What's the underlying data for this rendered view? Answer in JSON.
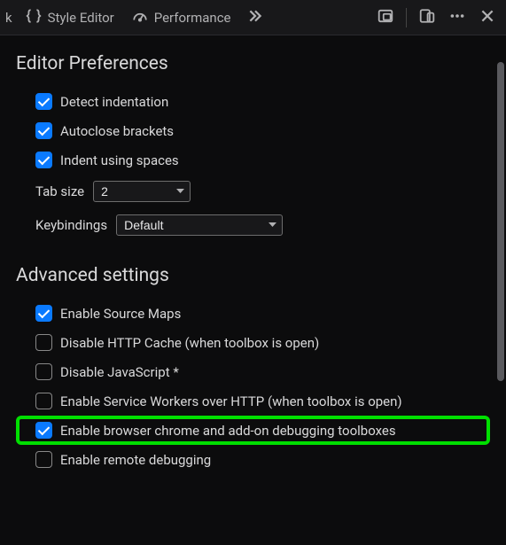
{
  "toolbar": {
    "style_editor_label": "Style Editor",
    "performance_label": "Performance",
    "cut_left": "k"
  },
  "editor_prefs": {
    "title": "Editor Preferences",
    "detect_indentation": "Detect indentation",
    "autoclose_brackets": "Autoclose brackets",
    "indent_using_spaces": "Indent using spaces",
    "tab_size_label": "Tab size",
    "tab_size_value": "2",
    "keybindings_label": "Keybindings",
    "keybindings_value": "Default"
  },
  "advanced": {
    "title": "Advanced settings",
    "enable_source_maps": "Enable Source Maps",
    "disable_http_cache": "Disable HTTP Cache (when toolbox is open)",
    "disable_javascript": "Disable JavaScript *",
    "enable_service_workers": "Enable Service Workers over HTTP (when toolbox is open)",
    "enable_browser_chrome": "Enable browser chrome and add-on debugging toolboxes",
    "enable_remote_debugging": "Enable remote debugging"
  }
}
